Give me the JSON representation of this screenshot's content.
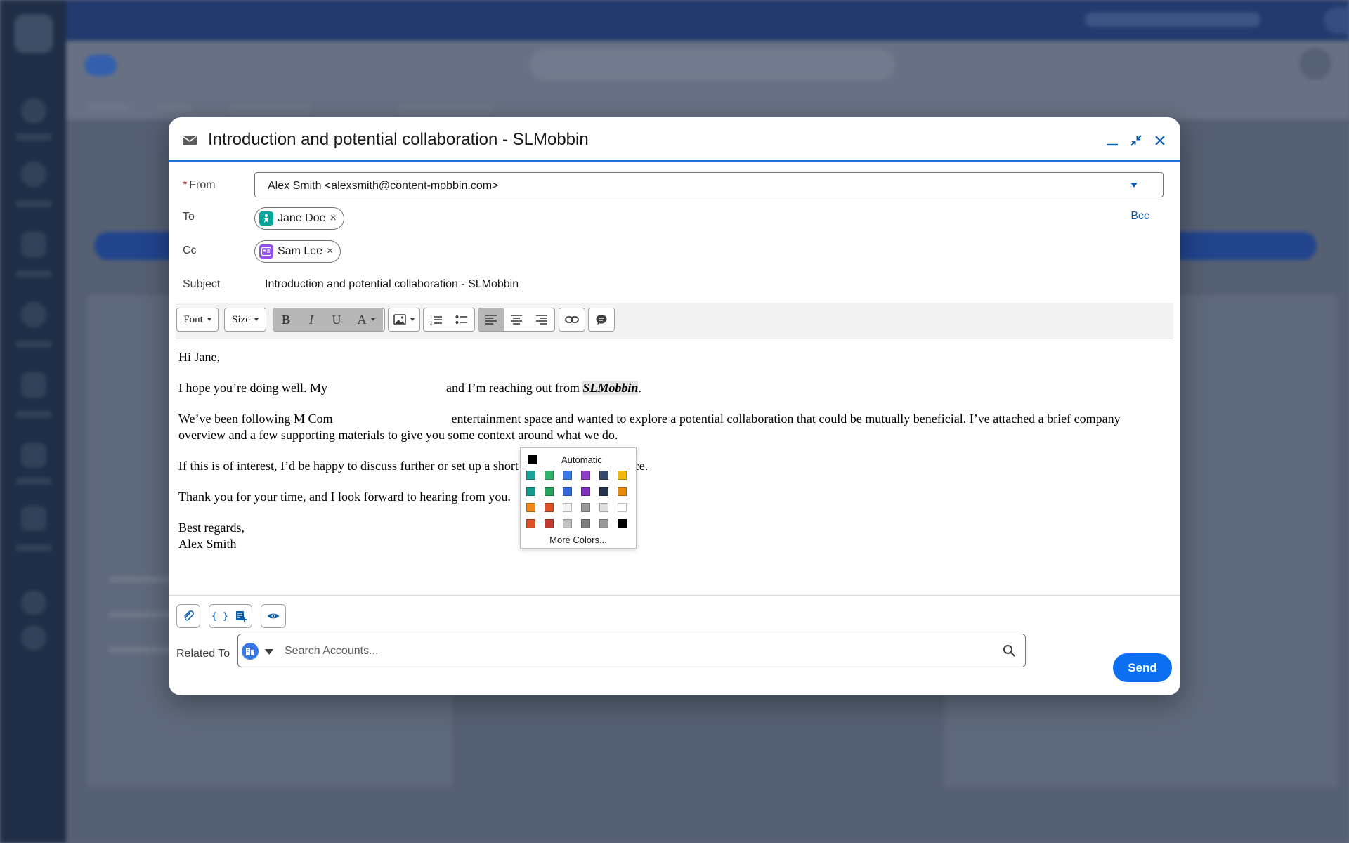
{
  "modal": {
    "title": "Introduction and potential collaboration - SLMobbin"
  },
  "form": {
    "from_label": "From",
    "from_required_mark": "*",
    "from_value": "Alex Smith <alexsmith@content-mobbin.com>",
    "to_label": "To",
    "to_recipients": [
      "Jane Doe"
    ],
    "cc_label": "Cc",
    "cc_recipients": [
      "Sam Lee"
    ],
    "remove_glyph": "×",
    "bcc_label": "Bcc",
    "subject_label": "Subject",
    "subject_value": "Introduction and potential collaboration - SLMobbin"
  },
  "toolbar": {
    "font_label": "Font",
    "size_label": "Size",
    "bold_label": "B",
    "italic_label": "I",
    "underline_label": "U",
    "text_color_label": "A"
  },
  "palette": {
    "automatic_label": "Automatic",
    "more_colors_label": "More Colors...",
    "automatic_color": "#000000",
    "rows": [
      [
        "#1aa398",
        "#2eb36b",
        "#3b78e7",
        "#8e3ec9",
        "#34486b",
        "#f0b70c"
      ],
      [
        "#159a8c",
        "#27a35c",
        "#3468d6",
        "#7c32bd",
        "#26324f",
        "#e68b0e"
      ],
      [
        "#ef8a1a",
        "#df5227",
        "#f3f3f3",
        "#9a9a9a",
        "#dedede",
        "#ffffff"
      ],
      [
        "#df5227",
        "#c43b2e",
        "#c2c2c2",
        "#7c7c7c",
        "#979797",
        "#000000"
      ]
    ]
  },
  "body": {
    "greeting": "Hi Jane,",
    "p1_a": "I hope you’re doing well. My",
    "p1_b": "and I’m reaching out from",
    "brand": "SLMobbin",
    "p1_end": ".",
    "p2_a": "We’ve been following M Com",
    "p2_b": "entertainment space and wanted to explore a potential collaboration that could be mutually beneficial. I’ve attached a brief company overview and a few supporting materials to give you some context around what we do.",
    "p3": "If this is of interest, I’d be happy to discuss further or set up a short call at your convenience.",
    "p4": "Thank you for your time, and I look forward to hearing from you.",
    "signoff": "Best regards,",
    "signature": "Alex Smith"
  },
  "footer": {
    "related_label": "Related To",
    "search_placeholder": "Search Accounts...",
    "send_label": "Send"
  },
  "colors": {
    "accent": "#0b6ff0",
    "link": "#0b5cab",
    "contact_icon": "#06a59a",
    "lead_icon": "#9050e9"
  }
}
